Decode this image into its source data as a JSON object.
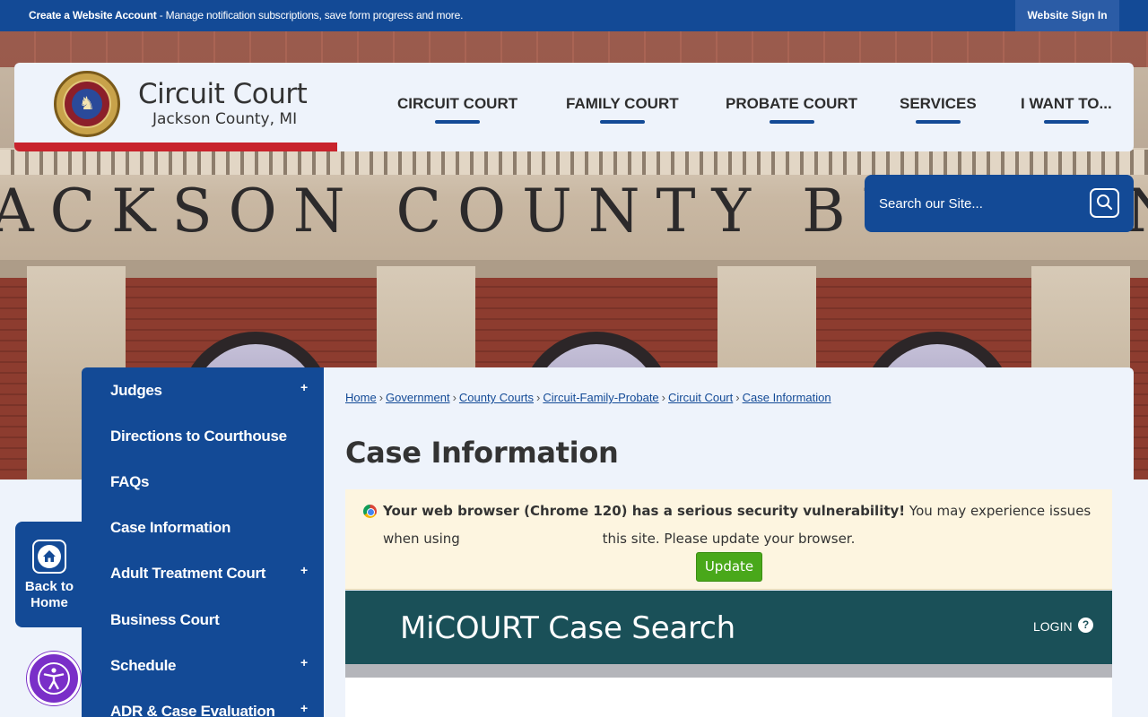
{
  "topbar": {
    "create_label": "Create a Website Account",
    "create_desc": " - Manage notification subscriptions, save form progress and more.",
    "signin_label": "Website Sign In"
  },
  "hero": {
    "building_text": "ACKSON   COUNTY   BUILDIN"
  },
  "header": {
    "title": "Circuit Court",
    "subtitle": "Jackson County, MI",
    "nav": [
      "CIRCUIT COURT",
      "FAMILY COURT",
      "PROBATE COURT",
      "SERVICES",
      "I WANT TO..."
    ]
  },
  "search": {
    "placeholder": "Search our Site..."
  },
  "back_home": {
    "label_line1": "Back to",
    "label_line2": "Home"
  },
  "sidebar": {
    "items": [
      {
        "label": "Judges",
        "expandable": "+"
      },
      {
        "label": "Directions to Courthouse",
        "expandable": ""
      },
      {
        "label": "FAQs",
        "expandable": ""
      },
      {
        "label": "Case Information",
        "expandable": ""
      },
      {
        "label": "Adult Treatment Court",
        "expandable": "+"
      },
      {
        "label": "Business Court",
        "expandable": ""
      },
      {
        "label": "Schedule",
        "expandable": "+"
      },
      {
        "label": "ADR & Case Evaluation",
        "expandable": "+"
      }
    ]
  },
  "breadcrumbs": [
    "Home",
    "Government",
    "County Courts",
    "Circuit-Family-Probate",
    "Circuit Court",
    "Case Information"
  ],
  "breadcrumb_sep": "›",
  "page_title": "Case Information",
  "browser_warning": {
    "bold": "Your web browser (Chrome 120) has a serious security vulnerability!",
    "rest": " You may experience issues when using",
    "line2": "this site. Please update your browser.",
    "button": "Update"
  },
  "micourt": {
    "title": "MiCOURT Case Search",
    "login": "LOGIN",
    "help": "?"
  },
  "colors": {
    "primary": "#134a96",
    "accent_red": "#c8232c",
    "micourt_teal": "#1a5058",
    "update_green": "#49a81a"
  }
}
